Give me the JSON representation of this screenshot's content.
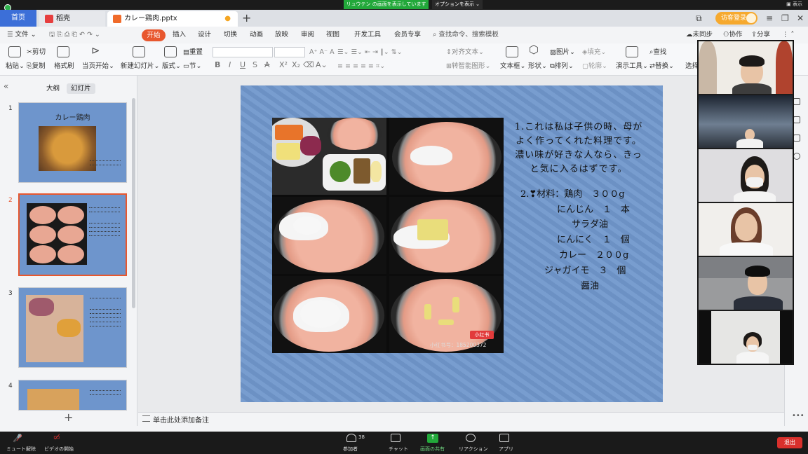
{
  "zoom_share": {
    "sharing_banner": "リュウテン の画面を表示しています",
    "view_options": "オプションを表示 ⌄",
    "display_label": "表示"
  },
  "tabs": {
    "home": "首页",
    "wps": "稻壳",
    "file": "カレー鶏肉.pptx",
    "visitor_login": "访客登录"
  },
  "menu": {
    "file": "文件",
    "items": [
      "开始",
      "插入",
      "设计",
      "切换",
      "动画",
      "放映",
      "审阅",
      "视图",
      "开发工具",
      "会员专享"
    ],
    "search": "查找命令、搜索模板",
    "sync": "未同步",
    "collab": "协作",
    "share": "分享"
  },
  "ribbon": {
    "paste": "粘贴",
    "cut": "剪切",
    "copy": "复制",
    "format_painter": "格式刷",
    "from_current": "当页开始",
    "new_slide": "新建幻灯片",
    "layout": "版式",
    "section": "节",
    "reset": "重置",
    "align_text": "对齐文本",
    "smartart": "转智能图形",
    "textbox": "文本框",
    "shape": "形状",
    "picture": "图片",
    "arrange": "排列",
    "fill": "填充",
    "outline": "轮廓",
    "presentation_tools": "演示工具",
    "find": "查找",
    "replace": "替换",
    "select": "选择"
  },
  "left_panel": {
    "outline_tab": "大纲",
    "slides_tab": "幻灯片",
    "slide_numbers": [
      "1",
      "2",
      "3",
      "4"
    ],
    "thumb1_title": "カレー鶏肉"
  },
  "slide": {
    "intro": "1.これは私は子供の時、母がよく作ってくれた料理です。濃い味が好きな人なら、きっと気に入るはずです。",
    "materials_head": "2.❣材料：鶏肉　３００g",
    "ingredients": [
      "にんじん　１　本",
      "サラダ油",
      "にんにく　１　個",
      "カレー　２００g",
      "ジャガイモ　３　個",
      "醤油"
    ],
    "watermark_badge": "小红书",
    "watermark_id": "小红书号：185200372"
  },
  "notes": {
    "placeholder": "单击此处添加备注"
  },
  "zoom_bar": {
    "mute": "ミュート解除",
    "video": "ビデオの開始",
    "participants": "参加者",
    "participant_count": "38",
    "chat": "チャット",
    "share_screen": "画面の共有",
    "reactions": "リアクション",
    "apps": "アプリ",
    "leave": "退出"
  },
  "colors": {
    "accent_orange": "#e8572e",
    "home_tab_blue": "#3c6fd8",
    "share_green": "#22a83a",
    "slide_blue": "#7097cc",
    "leave_red": "#d9302c"
  }
}
